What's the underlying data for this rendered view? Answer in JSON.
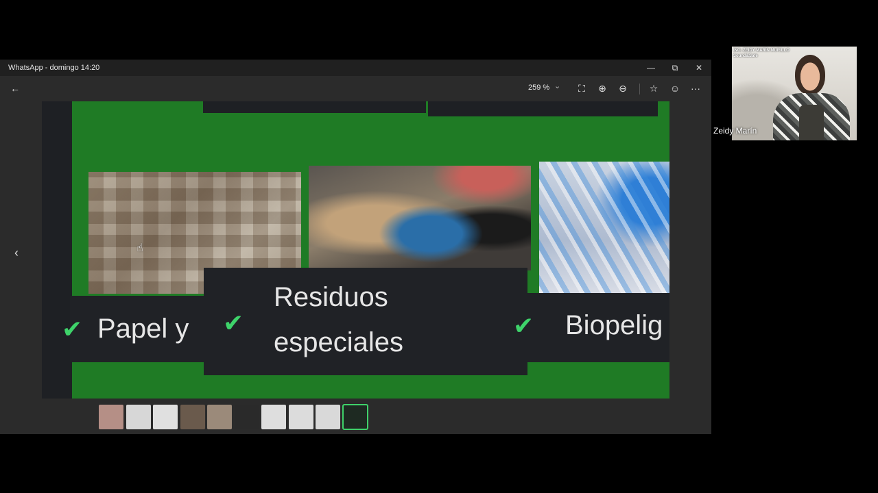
{
  "window": {
    "title": "WhatsApp - domingo 14:20",
    "controls": {
      "minimize": "—",
      "restore": "⧉",
      "close": "✕"
    }
  },
  "toolbar": {
    "back_icon": "←",
    "zoom_level": "259 %",
    "zoom_dropdown_icon": "⌄",
    "fit_icon": "⛶",
    "zoom_in_icon": "⊕",
    "zoom_out_icon": "⊖",
    "favorite_icon": "☆",
    "react_icon": "☺",
    "more_icon": "···"
  },
  "image": {
    "cards": [
      {
        "check": "✔",
        "text": "Papel y"
      },
      {
        "check": "✔",
        "line1": "Residuos",
        "line2": "especiales"
      },
      {
        "check": "✔",
        "text": "Biopelig"
      }
    ],
    "cursor_icon": "☝"
  },
  "nav": {
    "previous_icon": "‹"
  },
  "filmstrip": {
    "thumbnails": [
      {
        "color": "#b58f86"
      },
      {
        "color": "#d7d7d7"
      },
      {
        "color": "#e0e0e0"
      },
      {
        "color": "#6a5a4c"
      },
      {
        "color": "#9b8a7a"
      },
      {
        "color": "#2a2a2a"
      },
      {
        "color": "#dedede"
      },
      {
        "color": "#dcdcdc"
      },
      {
        "color": "#d9d9d9"
      },
      {
        "color": "#1e2a22",
        "active": true
      }
    ]
  },
  "video": {
    "brand_line1": "ING. ZEIDY MARÍN MURILLO",
    "brand_line2": "Sound&Safe",
    "participant_name": "Zeidy Marín"
  },
  "colors": {
    "accent_green": "#3fd26a",
    "slide_green": "#1f7b25"
  }
}
